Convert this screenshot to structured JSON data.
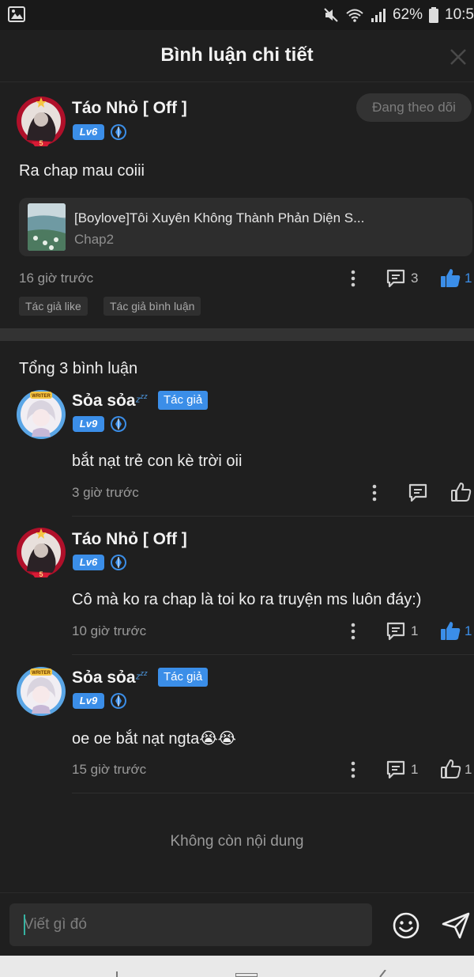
{
  "status_bar": {
    "battery": "62%",
    "time": "10:5"
  },
  "header": {
    "title": "Bình luận chi tiết"
  },
  "post": {
    "author": "Táo Nhỏ [ Off ]",
    "level": "Lv6",
    "follow_label": "Đang theo dõi",
    "text": "Ra chap mau coiii",
    "chapter": {
      "title": "[Boylove]Tôi Xuyên Không Thành Phản Diện S...",
      "subtitle": "Chap2"
    },
    "time": "16 giờ trước",
    "reply_count": "3",
    "like_count": "1",
    "tags": [
      "Tác giả like",
      "Tác giả bình luận"
    ]
  },
  "comments_section": {
    "total": "Tổng 3 bình luận"
  },
  "comments": [
    {
      "author": "Sỏa sỏa",
      "badge": "Tác giả",
      "level": "Lv9",
      "text": "bắt nạt trẻ con kè trời oii",
      "time": "3 giờ trước",
      "reply_count": "",
      "like_count": ""
    },
    {
      "author": "Táo Nhỏ [ Off ]",
      "badge": "",
      "level": "Lv6",
      "text": "Cô mà ko ra chap là toi ko ra truyện ms luôn đáy:)",
      "time": "10 giờ trước",
      "reply_count": "1",
      "like_count": "1"
    },
    {
      "author": "Sỏa sỏa",
      "badge": "Tác giả",
      "level": "Lv9",
      "text": "oe oe bắt nạt ngta😭😭",
      "time": "15 giờ trước",
      "reply_count": "1",
      "like_count": "1"
    }
  ],
  "end_text": "Không còn nội dung",
  "input": {
    "placeholder": "Viết gì đó"
  },
  "colors": {
    "accent": "#3b8ee8",
    "background": "#1f1f1f"
  }
}
